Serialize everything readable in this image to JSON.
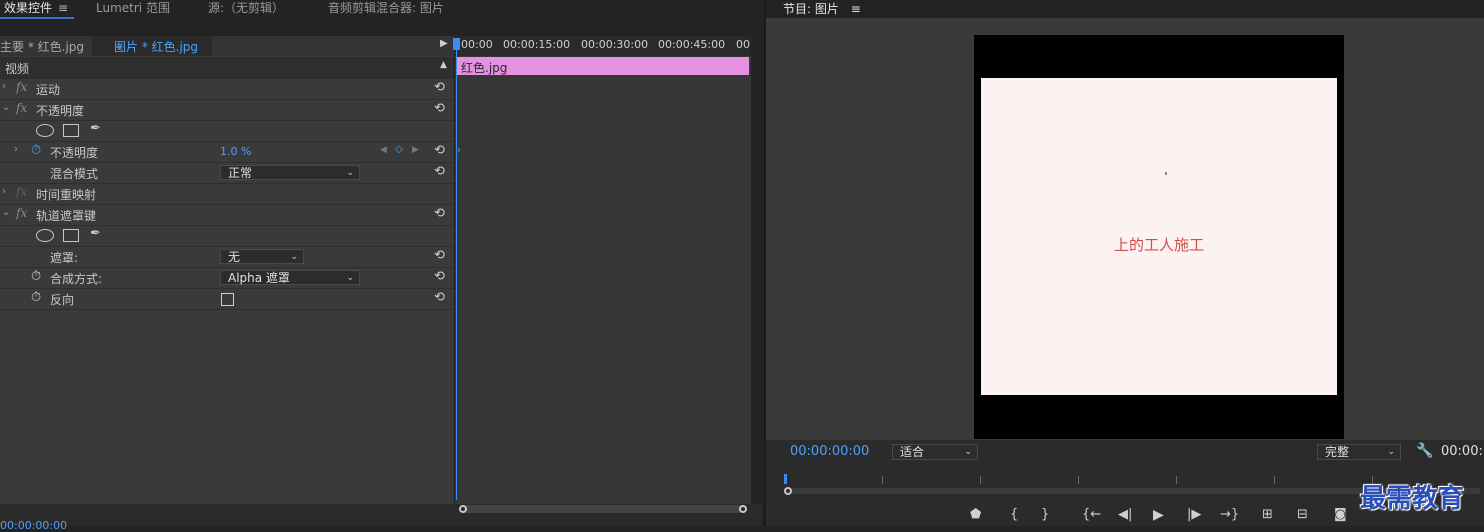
{
  "tabs": {
    "effects": "效果控件",
    "menu": "≡",
    "lumetri": "Lumetri 范围",
    "source": "源:（无剪辑）",
    "mixer": "音频剪辑混合器: 图片"
  },
  "source_bar": {
    "master": "主要 * 红色.jpg",
    "clip": "图片 * 红色.jpg"
  },
  "ruler": [
    "00:00",
    "00:00:15:00",
    "00:00:30:00",
    "00:00:45:00",
    "00"
  ],
  "clip": {
    "name": "红色.jpg",
    "color": "#e391e0"
  },
  "properties": {
    "video_header": "视频",
    "motion": "运动",
    "opacity": "不透明度",
    "opacity_param": "不透明度",
    "opacity_value": "1.0 %",
    "blend_mode_label": "混合模式",
    "blend_mode_value": "正常",
    "time_remap": "时间重映射",
    "track_matte": "轨道遮罩键",
    "matte_label": "遮罩:",
    "matte_value": "无",
    "composite_label": "合成方式:",
    "composite_value": "Alpha 遮罩",
    "reverse_label": "反向"
  },
  "left_bottom_time": "00:00:00:00",
  "program": {
    "title": "节目: 图片",
    "menu": "≡",
    "timecode": "00:00:00:00",
    "fit": "适合",
    "quality": "完整",
    "right_time": "00:00:",
    "frame_text": "上的工人施工"
  },
  "watermark": "最需教育",
  "colors": {
    "accent": "#4aa3ff",
    "clip": "#e391e0"
  }
}
